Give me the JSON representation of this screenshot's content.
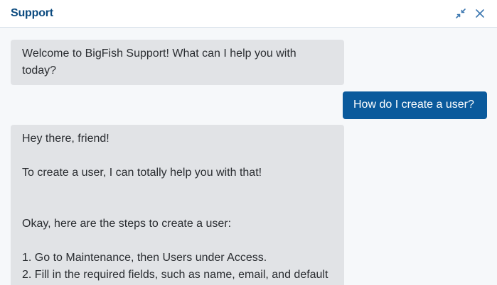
{
  "header": {
    "title": "Support",
    "minimize_icon": "collapse-arrows-icon",
    "close_icon": "close-icon",
    "accent_color": "#0b4a7f"
  },
  "messages": [
    {
      "sender": "bot",
      "text": "Welcome to BigFish Support! What can I help you with today?"
    },
    {
      "sender": "user",
      "text": "How do I create a user?"
    },
    {
      "sender": "bot",
      "text": "Hey there, friend!\n\nTo create a user, I can totally help you with that!\n\n\nOkay, here are the steps to create a user:\n\n1. Go to Maintenance, then Users under Access.\n2. Fill in the required fields, such as name, email, and default"
    }
  ],
  "colors": {
    "bot_bubble": "#e1e3e6",
    "user_bubble": "#0a5a9c",
    "background": "#f6f8fa"
  }
}
